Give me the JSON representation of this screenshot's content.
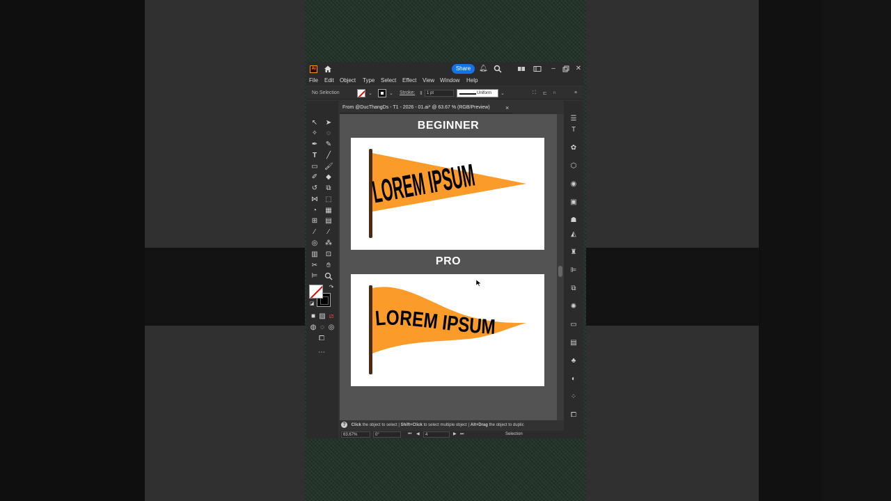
{
  "titlebar": {
    "app_logo": "Ai",
    "share_label": "Share"
  },
  "menu": [
    "File",
    "Edit",
    "Object",
    "Type",
    "Select",
    "Effect",
    "View",
    "Window",
    "Help"
  ],
  "control": {
    "selection_label": "No Selection",
    "stroke_label": "Stroke:",
    "stroke_value": "1 pt",
    "profile_label": "Uniform"
  },
  "document": {
    "tab_title": "From @DucThangDs - T1 - 2026 - 01.ai* @ 63.67 % (RGB/Preview)",
    "close_glyph": "×"
  },
  "artboards": [
    {
      "heading": "BEGINNER",
      "flag_text": "LOREM IPSUM"
    },
    {
      "heading": "PRO",
      "flag_text": "LOREM IPSUM"
    }
  ],
  "status": {
    "help_glyph": "?",
    "hint_click": "Click",
    "hint_click_rest": " the object to select  |  ",
    "hint_shift": "Shift+Click",
    "hint_shift_rest": " to select multiple object  |  ",
    "hint_alt": "Alt+Drag",
    "hint_alt_rest": " the object to duplic",
    "zoom": "63.67%",
    "rotation": "0°",
    "artboard_num": "4",
    "tool_name": "Selection"
  },
  "colors": {
    "flag_orange": "#fb9c2a",
    "pole_brown": "#4a2a12",
    "share_blue": "#1473e6"
  }
}
